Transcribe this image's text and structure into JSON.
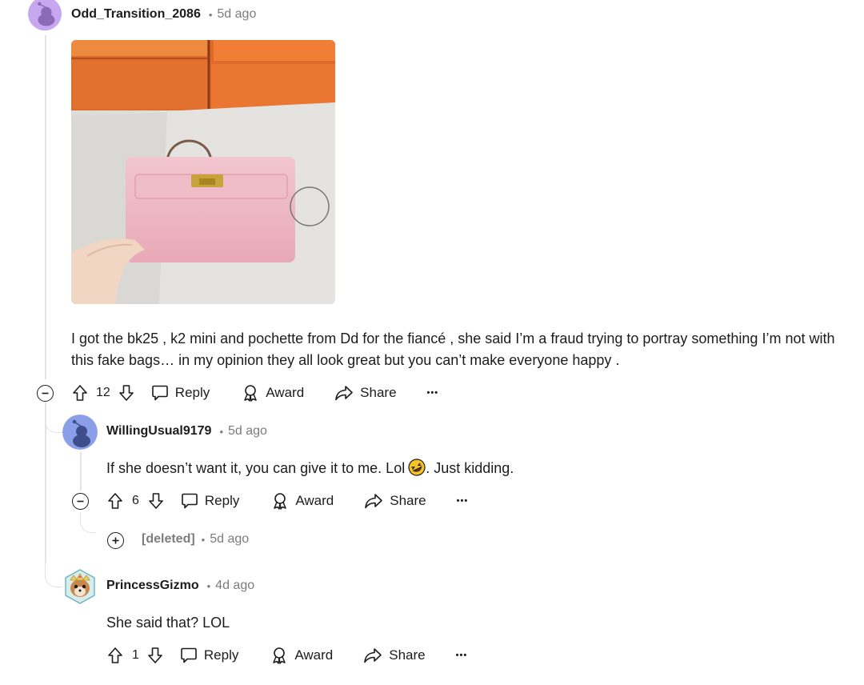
{
  "comments": [
    {
      "username": "Odd_Transition_2086",
      "time": "5d ago",
      "body": "I got the bk25 , k2 mini and pochette from Dd for the fiancé , she said I’m a fraud trying to portray something I’m not with this fake bags… in my opinion they all look great but you can’t make everyone happy .",
      "votes": "12",
      "avatar_color": "#c7a7f0"
    },
    {
      "username": "WillingUsual9179",
      "time": "5d ago",
      "body_before": "If she doesn’t want it, you can give it to me. Lol",
      "body_after": ". Just kidding.",
      "votes": "6",
      "avatar_color": "#8b9ee8"
    },
    {
      "username": "[deleted]",
      "time": "5d ago"
    },
    {
      "username": "PrincessGizmo",
      "time": "4d ago",
      "body": "She said that? LOL",
      "votes": "1"
    }
  ],
  "actions": {
    "reply": "Reply",
    "award": "Award",
    "share": "Share",
    "more": "•••"
  },
  "separator": "•",
  "icons": {
    "upvote": "upvote-icon",
    "downvote": "downvote-icon",
    "reply": "comment-bubble-icon",
    "award": "award-icon",
    "share": "share-arrow-icon",
    "collapse": "minus-circle-icon",
    "expand": "plus-circle-icon",
    "emoji": "rofl-emoji-icon"
  }
}
